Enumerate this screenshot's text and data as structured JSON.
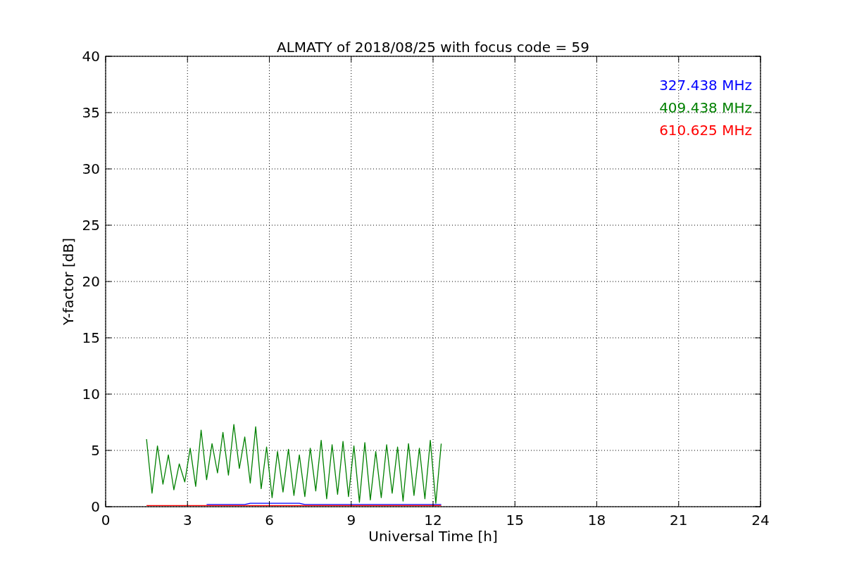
{
  "chart": {
    "chart_data": {
      "type": "line",
      "title": "ALMATY of 2018/08/25 with focus code = 59",
      "xlabel": "Universal Time [h]",
      "ylabel": "Y-factor [dB]",
      "grid": true,
      "x": [
        1.5,
        1.7,
        1.9,
        2.1,
        2.3,
        2.5,
        2.7,
        2.9,
        3.1,
        3.3,
        3.5,
        3.7,
        3.9,
        4.1,
        4.3,
        4.5,
        4.7,
        4.9,
        5.1,
        5.3,
        5.5,
        5.7,
        5.9,
        6.1,
        6.3,
        6.5,
        6.7,
        6.9,
        7.1,
        7.3,
        7.5,
        7.7,
        7.9,
        8.1,
        8.3,
        8.5,
        8.7,
        8.9,
        9.1,
        9.3,
        9.5,
        9.7,
        9.9,
        10.1,
        10.3,
        10.5,
        10.7,
        10.9,
        11.1,
        11.3,
        11.5,
        11.7,
        11.9,
        12.1,
        12.3
      ],
      "series": [
        {
          "name": "327.438 MHz",
          "color": "#0000ff",
          "values": [
            null,
            null,
            null,
            null,
            null,
            null,
            null,
            null,
            null,
            null,
            null,
            0.2,
            0.2,
            0.2,
            0.2,
            0.2,
            0.2,
            0.2,
            0.2,
            0.3,
            0.3,
            0.3,
            0.3,
            0.3,
            0.3,
            0.3,
            0.3,
            0.3,
            0.3,
            0.2,
            0.2,
            0.2,
            0.2,
            0.2,
            0.2,
            0.2,
            0.2,
            0.2,
            0.2,
            0.2,
            0.2,
            0.2,
            0.2,
            0.2,
            0.2,
            0.2,
            0.2,
            0.2,
            0.2,
            0.2,
            0.2,
            0.2,
            0.2,
            0.2,
            0.2
          ]
        },
        {
          "name": "409.438 MHz",
          "color": "#008000",
          "values": [
            6.0,
            1.2,
            5.4,
            2.0,
            4.6,
            1.5,
            3.8,
            2.2,
            5.2,
            1.8,
            6.8,
            2.4,
            5.6,
            3.0,
            6.6,
            2.8,
            7.3,
            3.4,
            6.2,
            2.1,
            7.1,
            1.6,
            5.3,
            0.8,
            4.9,
            1.3,
            5.1,
            1.0,
            4.6,
            0.9,
            5.2,
            1.4,
            5.9,
            0.7,
            5.5,
            1.1,
            5.8,
            0.9,
            5.4,
            0.4,
            5.7,
            0.6,
            4.9,
            0.8,
            5.5,
            1.2,
            5.3,
            0.5,
            5.6,
            1.0,
            5.2,
            0.7,
            5.9,
            0.3,
            5.6
          ]
        },
        {
          "name": "610.625 MHz",
          "color": "#ff0000",
          "values": [
            0.1,
            0.1,
            0.1,
            0.1,
            0.1,
            0.1,
            0.1,
            0.1,
            0.1,
            0.1,
            0.1,
            0.1,
            0.1,
            0.1,
            0.1,
            0.1,
            0.1,
            0.1,
            0.1,
            0.1,
            0.1,
            0.1,
            0.1,
            0.1,
            0.1,
            0.1,
            0.1,
            0.1,
            0.1,
            0.1,
            0.1,
            0.1,
            0.1,
            0.1,
            0.1,
            0.1,
            0.1,
            0.1,
            0.1,
            0.1,
            0.1,
            0.1,
            0.1,
            0.1,
            0.1,
            0.1,
            0.1,
            0.1,
            0.1,
            0.1,
            0.1,
            0.1,
            0.1,
            0.1,
            0.1
          ]
        }
      ],
      "xlim": [
        0,
        24
      ],
      "ylim": [
        0,
        40
      ],
      "xticks": [
        0,
        3,
        6,
        9,
        12,
        15,
        18,
        21,
        24
      ],
      "yticks": [
        0,
        5,
        10,
        15,
        20,
        25,
        30,
        35,
        40
      ]
    }
  }
}
